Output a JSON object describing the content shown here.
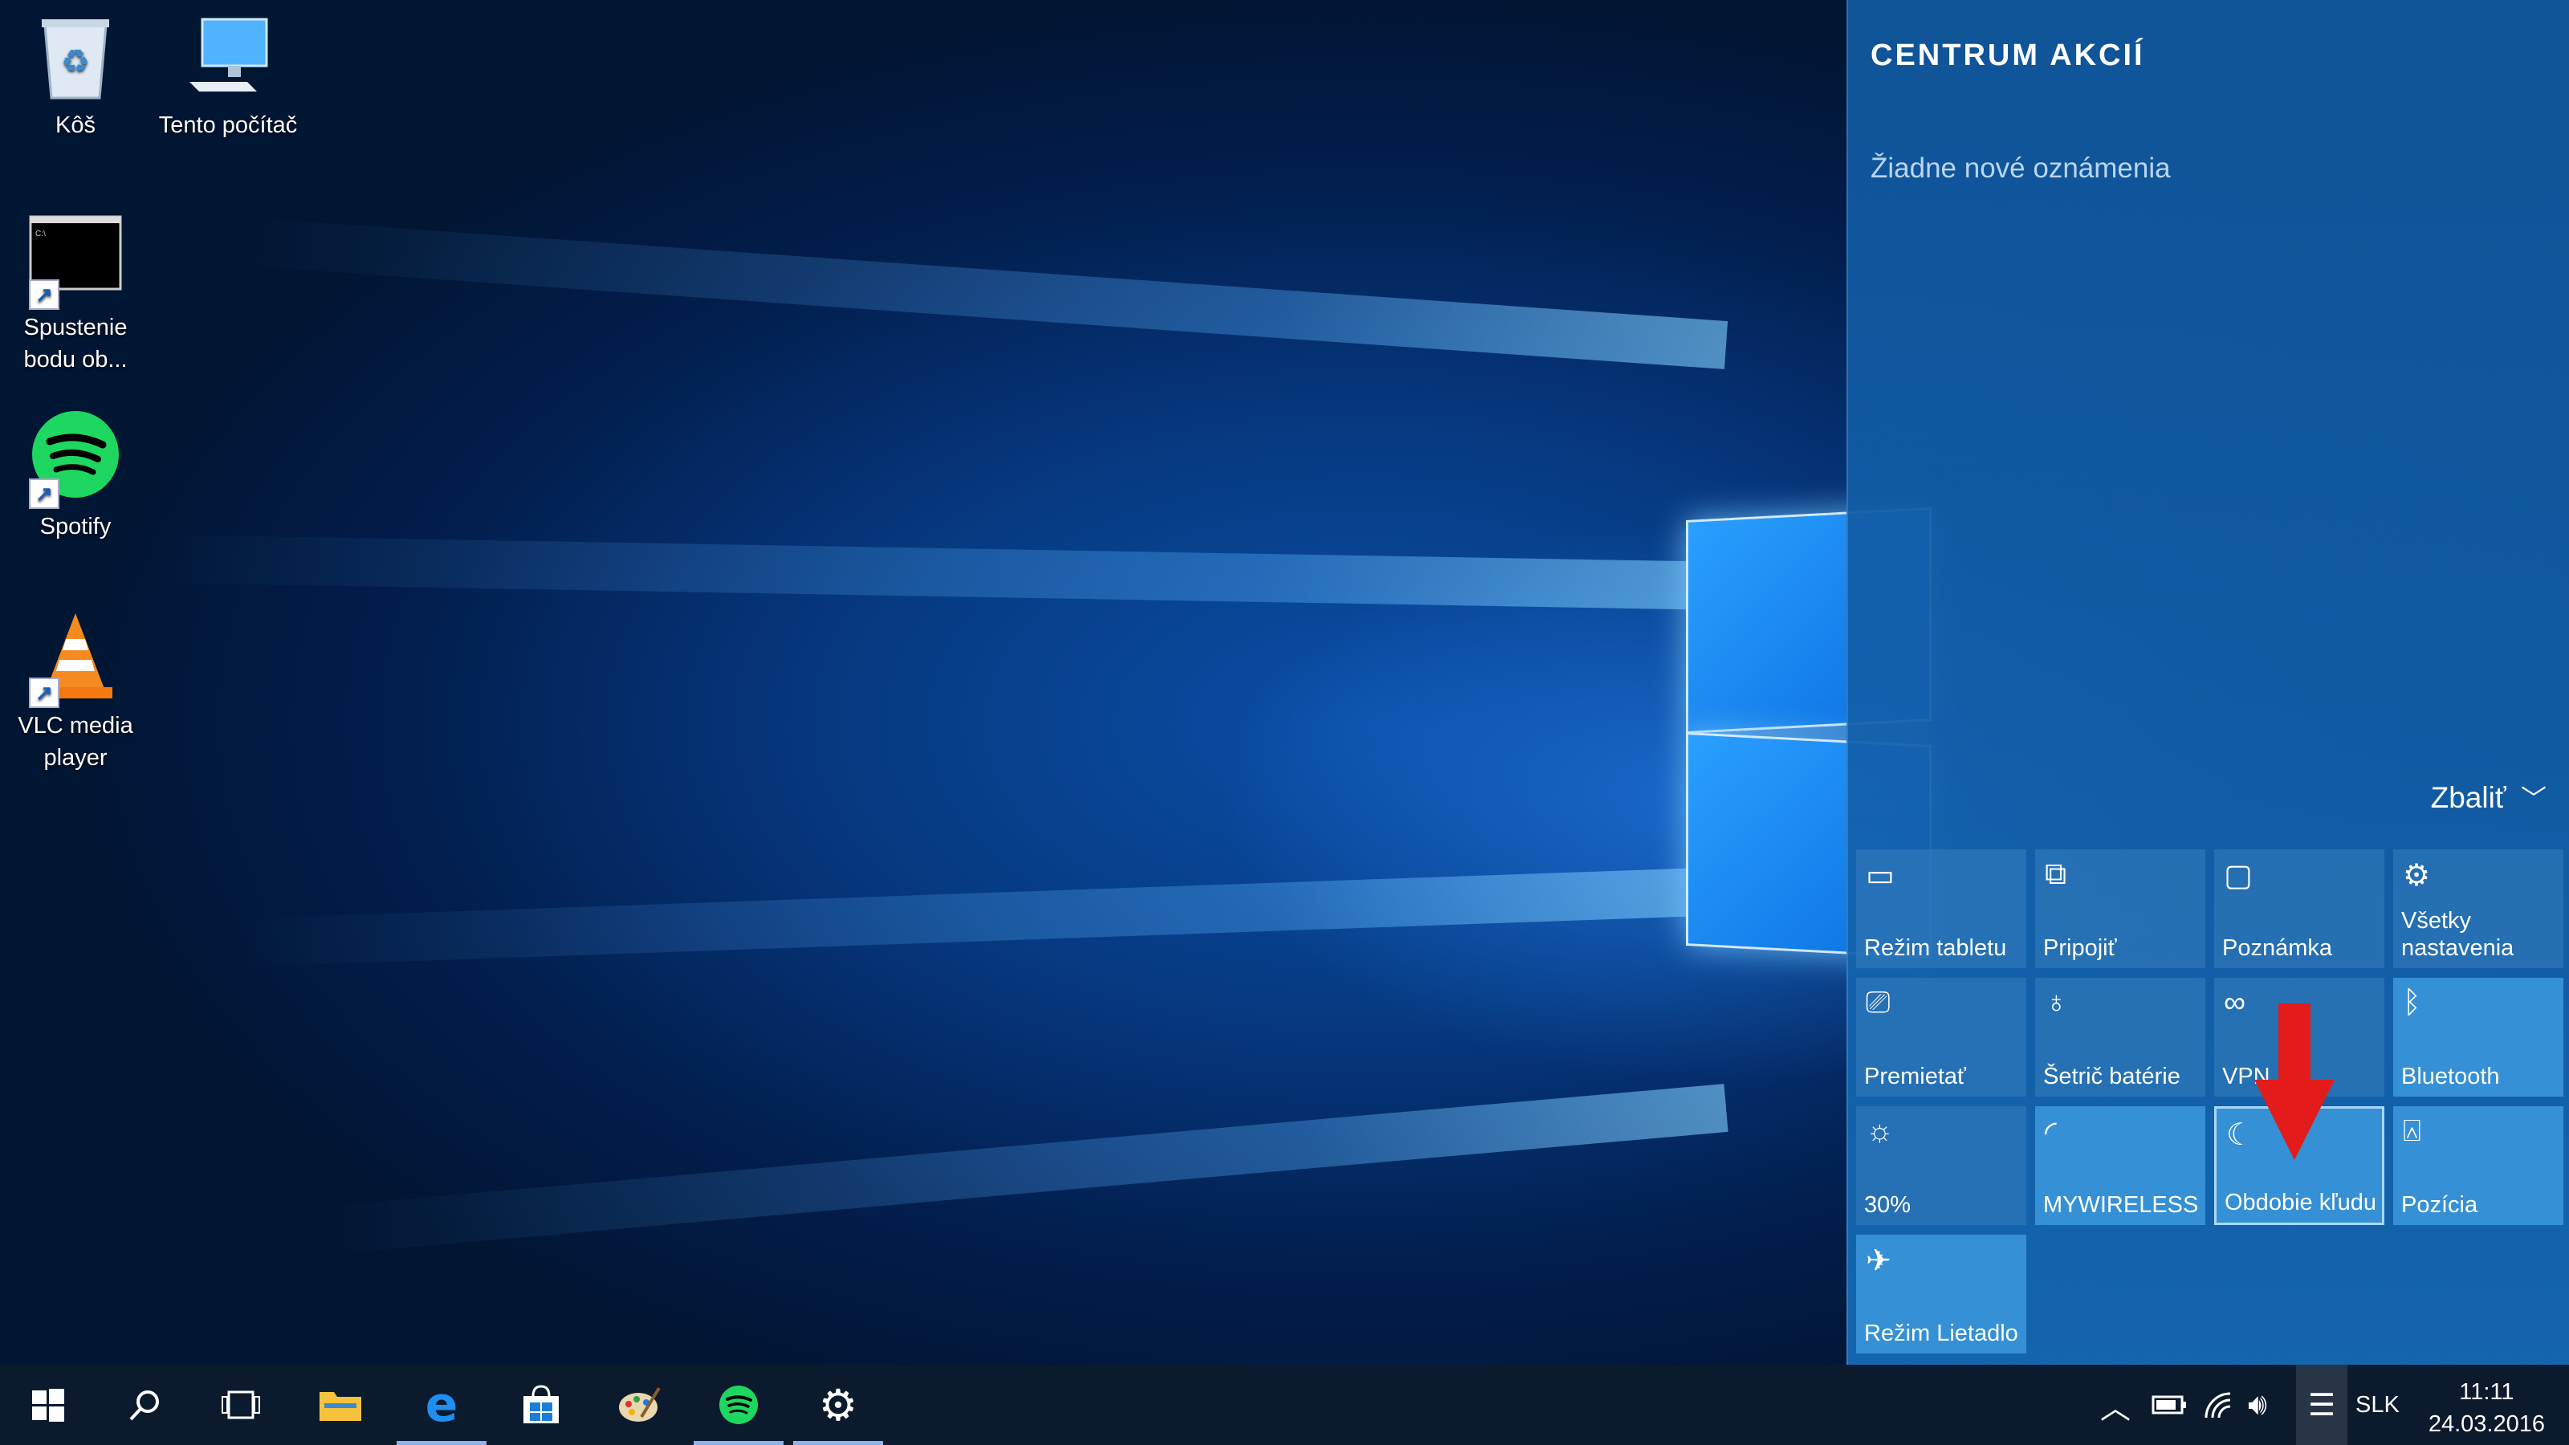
{
  "desktop": {
    "icons": [
      {
        "label": "Kôš"
      },
      {
        "label": "Tento počítač"
      },
      {
        "label": "Spustenie bodu ob..."
      },
      {
        "label": "Spotify"
      },
      {
        "label": "VLC media player"
      }
    ]
  },
  "action_center": {
    "title": "CENTRUM AKCIÍ",
    "empty_text": "Žiadne nové oznámenia",
    "collapse_label": "Zbaliť",
    "tiles": [
      {
        "label": "Režim tabletu",
        "icon": "tablet-mode-icon",
        "on": false
      },
      {
        "label": "Pripojiť",
        "icon": "connect-icon",
        "on": false
      },
      {
        "label": "Poznámka",
        "icon": "note-icon",
        "on": false
      },
      {
        "label": "Všetky nastavenia",
        "icon": "gear-icon",
        "on": false
      },
      {
        "label": "Premietať",
        "icon": "project-icon",
        "on": false
      },
      {
        "label": "Šetrič batérie",
        "icon": "battery-saver-icon",
        "on": false
      },
      {
        "label": "VPN",
        "icon": "vpn-icon",
        "on": false
      },
      {
        "label": "Bluetooth",
        "icon": "bluetooth-icon",
        "on": true
      },
      {
        "label": "30%",
        "icon": "brightness-icon",
        "on": false
      },
      {
        "label": "MYWIRELESS",
        "icon": "wifi-icon",
        "on": true
      },
      {
        "label": "Obdobie kľudu",
        "icon": "quiet-hours-icon",
        "on": true
      },
      {
        "label": "Pozícia",
        "icon": "location-icon",
        "on": true
      },
      {
        "label": "Režim Lietadlo",
        "icon": "airplane-icon",
        "on": true
      }
    ]
  },
  "taskbar": {
    "language": "SLK",
    "time": "11:11",
    "date": "24.03.2016"
  },
  "colors": {
    "accent": "#3590d6",
    "highlight_arrow": "#e41b1b",
    "taskbar": "#0b1a2d"
  }
}
